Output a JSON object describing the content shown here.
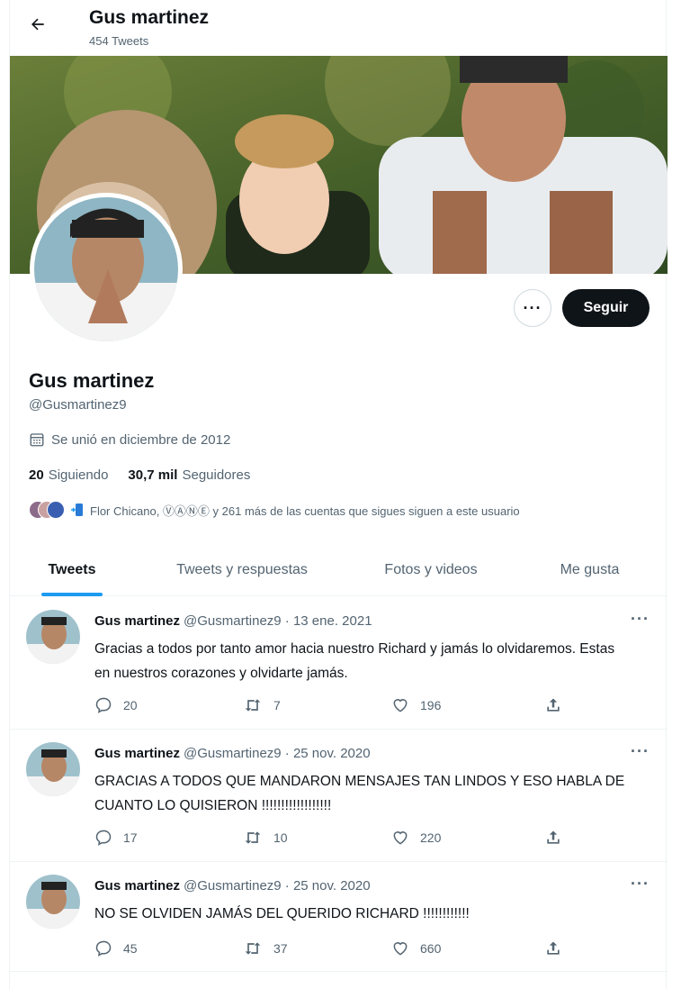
{
  "header": {
    "back_label": "Back",
    "name": "Gus martinez",
    "tweet_count": "454 Tweets"
  },
  "profile": {
    "name": "Gus martinez",
    "handle": "@Gusmartinez9",
    "joined": "Se unió en diciembre de 2012",
    "following_count": "20",
    "following_label": "Siguiendo",
    "followers_count": "30,7 mil",
    "followers_label": "Seguidores",
    "followed_by": "Flor Chicano, ⓋⒶⓃⒺ y 261 más de las cuentas que sigues siguen a este usuario"
  },
  "buttons": {
    "more": "···",
    "follow": "Seguir"
  },
  "tabs": [
    {
      "label": "Tweets",
      "active": true
    },
    {
      "label": "Tweets y respuestas",
      "active": false
    },
    {
      "label": "Fotos y videos",
      "active": false
    },
    {
      "label": "Me gusta",
      "active": false
    }
  ],
  "tweets": [
    {
      "name": "Gus martinez",
      "meta": "@Gusmartinez9 · 13 ene. 2021",
      "text": "Gracias a todos por tanto amor hacia nuestro Richard y jamás lo olvidaremos. Estas en nuestros corazones y olvidarte jamás.",
      "replies": "20",
      "retweets": "7",
      "likes": "196"
    },
    {
      "name": "Gus martinez",
      "meta": "@Gusmartinez9 · 25 nov. 2020",
      "text": "GRACIAS A TODOS QUE MANDARON MENSAJES TAN LINDOS Y ESO HABLA DE CUANTO LO QUISIERON !!!!!!!!!!!!!!!!!!",
      "replies": "17",
      "retweets": "10",
      "likes": "220"
    },
    {
      "name": "Gus martinez",
      "meta": "@Gusmartinez9 · 25 nov. 2020",
      "text": "NO SE OLVIDEN JAMÁS DEL QUERIDO RICHARD !!!!!!!!!!!!",
      "replies": "45",
      "retweets": "37",
      "likes": "660"
    }
  ],
  "tweet_menu": "···",
  "colors": {
    "accent": "#1d9bf0",
    "text": "#0f1419",
    "secondary": "#536471",
    "follow_bg": "#0f1419"
  }
}
